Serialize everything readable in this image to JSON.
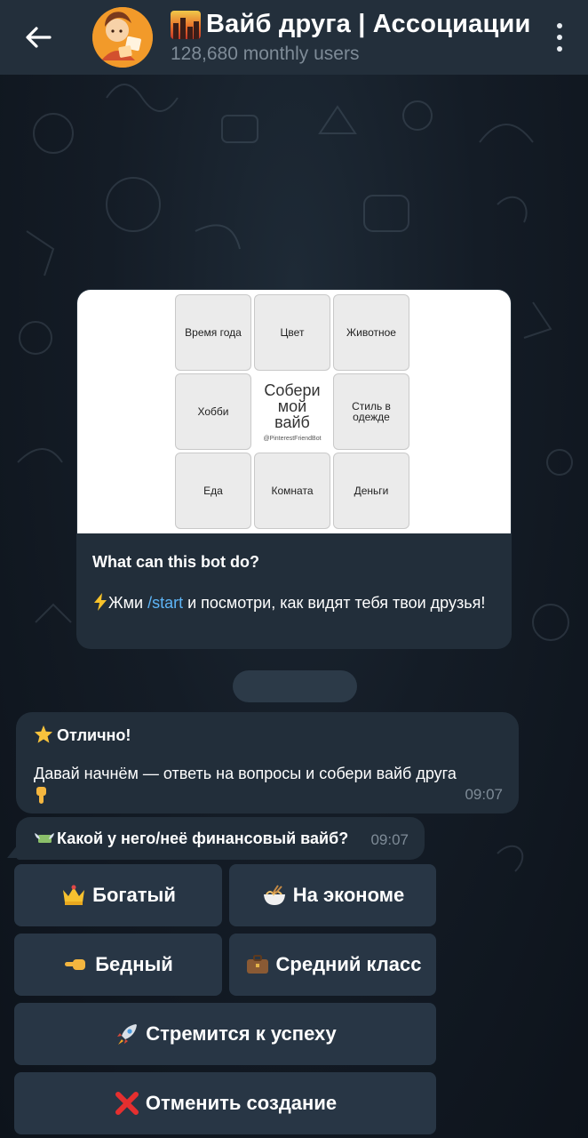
{
  "header": {
    "title": "Вайб друга | Ассоциации",
    "subtitle": "128,680 monthly users",
    "back_icon": "arrow-left-icon",
    "menu_icon": "more-vertical-icon"
  },
  "bot_card": {
    "grid": {
      "cells": [
        "Время года",
        "Цвет",
        "Животное",
        "Хобби",
        "",
        "Стиль в одежде",
        "Еда",
        "Комната",
        "Деньги"
      ],
      "center_title": "Собери мой вайб",
      "center_handle": "@PinterestFriendBot"
    },
    "heading": "What can this bot do?",
    "description_before": "Жми ",
    "description_link": "/start",
    "description_after": " и посмотри, как видят тебя твои друзья!"
  },
  "messages": [
    {
      "title": "Отлично!",
      "body": "Давай начнём — ответь на вопросы и собери вайб друга",
      "time": "09:07"
    },
    {
      "text": "Какой у него/неё финансовый вайб?",
      "time": "09:07"
    }
  ],
  "keyboard": [
    {
      "label": "Богатый",
      "icon": "crown-icon"
    },
    {
      "label": "На экономе",
      "icon": "noodle-bowl-icon"
    },
    {
      "label": "Бедный",
      "icon": "pointing-hand-icon"
    },
    {
      "label": "Средний класс",
      "icon": "briefcase-icon"
    },
    {
      "label": "Стремится к успеху",
      "icon": "rocket-icon"
    },
    {
      "label": "Отменить создание",
      "icon": "cross-mark-icon"
    }
  ],
  "colors": {
    "header_bg": "#232f3b",
    "bubble_bg": "#222e3a",
    "button_bg": "#283645",
    "link": "#5eb5f7",
    "subtext": "#7e8b97",
    "avatar": "#f29a2a"
  }
}
